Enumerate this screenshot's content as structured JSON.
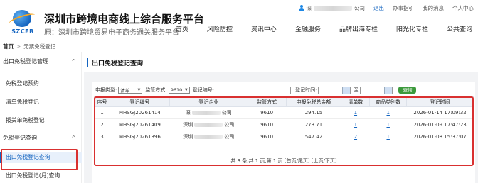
{
  "header": {
    "logo_text": "SZCEB",
    "title": "深圳市跨境电商线上综合服务平台",
    "subtitle": "原：深圳市跨境贸易电子商务通关服务平台",
    "user_prefix": "深",
    "user_suffix": "公司",
    "logout": "退出",
    "guide": "办事指引",
    "messages": "我的消息",
    "personal": "个人中心"
  },
  "nav": [
    "首页",
    "风险防控",
    "资讯中心",
    "金融服务",
    "品牌出海专栏",
    "阳光化专栏",
    "公共查询"
  ],
  "breadcrumb": {
    "home": "首页",
    "sep": ">",
    "current": "无票免税登记"
  },
  "sidebar": {
    "groups": [
      {
        "label": "出口免税登记管理",
        "chevron": "^"
      },
      {
        "label": "免税登记查询",
        "chevron": "^"
      }
    ],
    "items_group1": [
      "免税登记预约",
      "清单免税登记",
      "报关单免税登记"
    ],
    "items_group2": [
      "出口免税登记查询",
      "出口免税登记(月)查询"
    ]
  },
  "main": {
    "title": "出口免税登记查询",
    "filters": {
      "declare_type_label": "申报类型:",
      "declare_type_value": "清单",
      "regulatory_label": "监管方式:",
      "regulatory_value": "9610",
      "reg_no_label": "登记编号:",
      "reg_time_label": "登记时间:",
      "to_label": "至",
      "query_button": "查询"
    },
    "table": {
      "headers": [
        "序号",
        "登记编号",
        "登记企业",
        "监管方式",
        "申报免税总金额",
        "清单数",
        "商品类别数",
        "登记时间"
      ],
      "rows": [
        {
          "idx": "1",
          "reg_no": "MHSGJ20261414",
          "company_prefix": "深",
          "company_suffix": "公司",
          "mode": "9610",
          "amount": "294.15",
          "list_count": "1",
          "category_count": "1",
          "time": "2026-01-14 17:09:32"
        },
        {
          "idx": "2",
          "reg_no": "MHSGJ20261409",
          "company_prefix": "深圳",
          "company_suffix": "公司",
          "mode": "9610",
          "amount": "273.71",
          "list_count": "1",
          "category_count": "1",
          "time": "2026-01-09 17:47:23"
        },
        {
          "idx": "3",
          "reg_no": "MHSGJ20261396",
          "company_prefix": "深圳",
          "company_suffix": "公司",
          "mode": "9610",
          "amount": "547.42",
          "list_count": "2",
          "category_count": "1",
          "time": "2026-01-08 15:37:07"
        }
      ],
      "pager": "共 3 条,共 1 页,第 1 页 [首页/尾页] [上页/下页]"
    }
  },
  "colors": {
    "accent": "#1565c0",
    "highlight": "#d93030",
    "query_button": "#3c9a3c"
  }
}
